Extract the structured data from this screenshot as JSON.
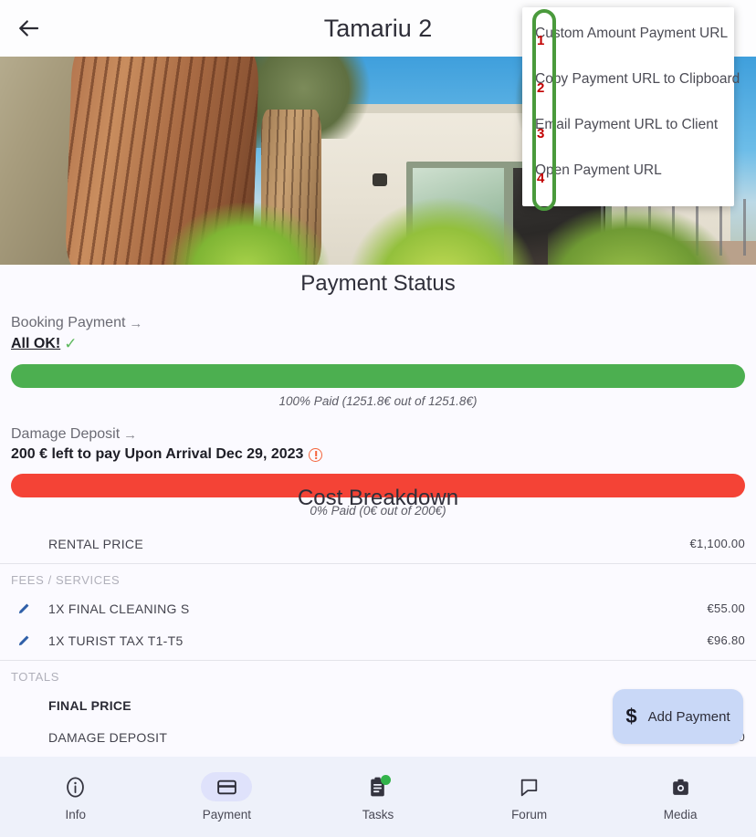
{
  "header": {
    "title": "Tamariu 2",
    "back_icon": "back-arrow-icon"
  },
  "hero": {
    "alt": "villa exterior with pine tree"
  },
  "menu": {
    "items": [
      {
        "index": "1",
        "label": "Custom Amount Payment URL"
      },
      {
        "index": "2",
        "label": "Copy Payment URL to Clipboard"
      },
      {
        "index": "3",
        "label": "Email Payment URL to Client"
      },
      {
        "index": "4",
        "label": "Open Payment URL"
      }
    ]
  },
  "annotation": {
    "highlight_color": "#4a9a3c",
    "number_color": "#c20000"
  },
  "payment_status": {
    "title": "Payment Status",
    "booking": {
      "label": "Booking Payment",
      "arrow": "→",
      "status_text": "All OK!",
      "status_icon": "check-icon",
      "bar_color": "#4caf50",
      "bar_percent": 100,
      "caption": "100% Paid (1251.8€ out of 1251.8€)"
    },
    "deposit": {
      "label": "Damage Deposit",
      "arrow": "→",
      "status_text": "200 € left to pay  Upon Arrival  Dec 29, 2023",
      "status_icon": "warning-circle-icon",
      "bar_color": "#f44336",
      "bar_percent": 0,
      "caption": "0% Paid (0€ out of 200€)"
    }
  },
  "cost_breakdown": {
    "title": "Cost Breakdown",
    "rental": {
      "label": "RENTAL PRICE",
      "value": "€1,100.00"
    },
    "fees_header": "FEES / SERVICES",
    "fees": [
      {
        "label": "1X FINAL CLEANING S",
        "value": "€55.00",
        "icon": "pencil-icon"
      },
      {
        "label": "1X TURIST TAX T1-T5",
        "value": "€96.80",
        "icon": "pencil-icon"
      }
    ],
    "totals_header": "TOTALS",
    "totals": [
      {
        "label": "FINAL PRICE",
        "value": ""
      },
      {
        "label": "DAMAGE DEPOSIT",
        "value": "€200.00"
      }
    ]
  },
  "fab": {
    "label": "Add Payment",
    "icon": "dollar-icon"
  },
  "navbar": {
    "items": [
      {
        "label": "Info",
        "icon": "info-circle-icon",
        "active": false,
        "badge": false
      },
      {
        "label": "Payment",
        "icon": "credit-card-icon",
        "active": true,
        "badge": false
      },
      {
        "label": "Tasks",
        "icon": "clipboard-icon",
        "active": false,
        "badge": true
      },
      {
        "label": "Forum",
        "icon": "speech-bubble-icon",
        "active": false,
        "badge": false
      },
      {
        "label": "Media",
        "icon": "camera-icon",
        "active": false,
        "badge": false
      }
    ]
  }
}
